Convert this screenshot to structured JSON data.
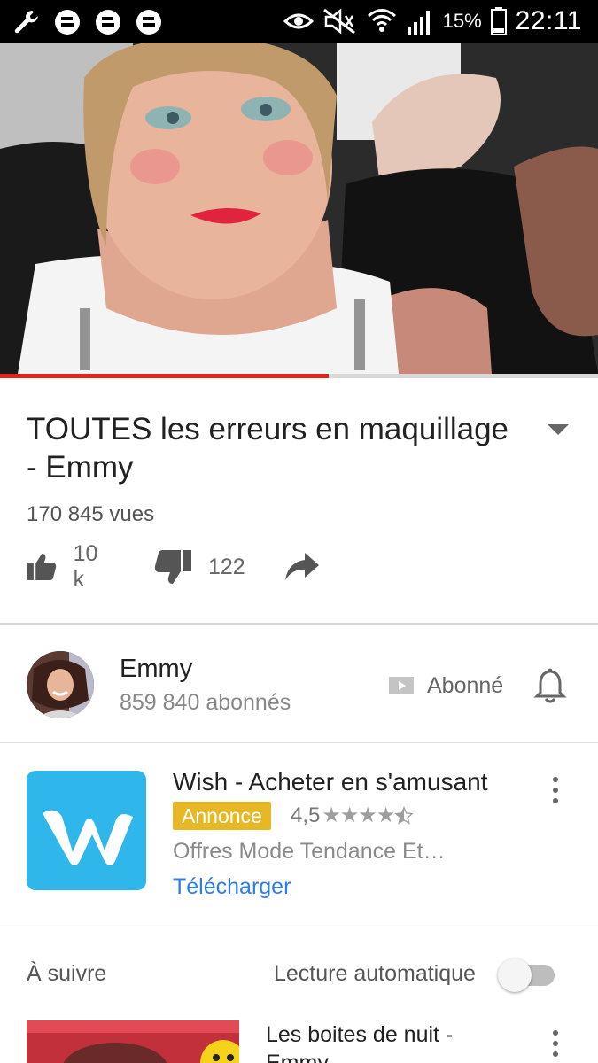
{
  "status_bar": {
    "battery_percent": "15%",
    "time": "22:11",
    "icons": [
      "wrench-icon",
      "messenger-icon",
      "messenger-icon",
      "messenger-icon",
      "eye-icon",
      "mute-icon",
      "wifi-icon",
      "signal-icon",
      "battery-icon"
    ]
  },
  "player": {
    "progress_fraction": 0.55,
    "progress_color": "#e62117"
  },
  "video": {
    "title": "TOUTES les erreurs en maquillage - Emmy",
    "views": "170 845 vues",
    "likes": "10 k",
    "dislikes": "122"
  },
  "channel": {
    "name": "Emmy",
    "subscribers": "859 840 abonnés",
    "subscribe_label": "Abonné"
  },
  "ad": {
    "title": "Wish - Acheter en s'amusant",
    "badge": "Annonce",
    "rating": "4,5",
    "stars": "★★★★",
    "description": "Offres Mode Tendance Et…",
    "cta": "Télécharger",
    "badge_color": "#e6b826",
    "logo_color": "#2fb7ec"
  },
  "up_next": {
    "label": "À suivre",
    "autoplay_label": "Lecture automatique",
    "autoplay_on": false,
    "next_title": "Les boites de nuit - Emmy"
  }
}
